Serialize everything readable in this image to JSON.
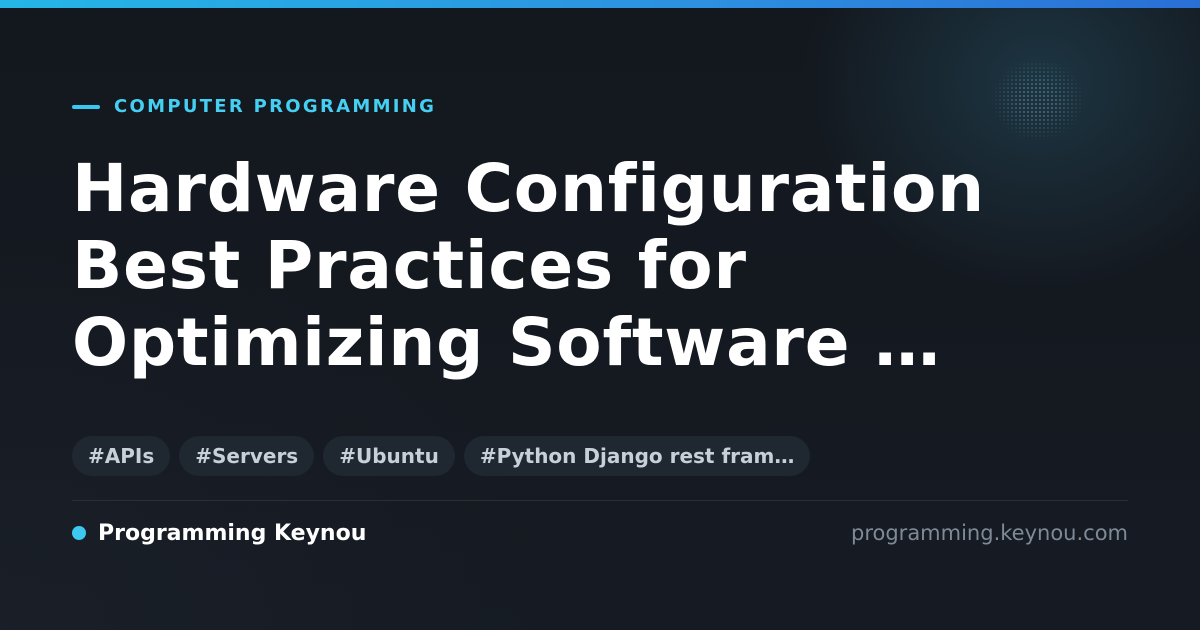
{
  "category": "COMPUTER PROGRAMMING",
  "title_lines": [
    "Hardware Configuration",
    "Best Practices for",
    "Optimizing Software …"
  ],
  "tags": [
    "#APIs",
    "#Servers",
    "#Ubuntu",
    "#Python Django rest fram…"
  ],
  "footer": {
    "brand": "Programming Keynou",
    "url": "programming.keynou.com"
  },
  "colors": {
    "accent": "#3cc8ef",
    "background": "#12161d",
    "tag_background": "#1f2731",
    "title": "#ffffff",
    "url": "#7e8a96"
  }
}
